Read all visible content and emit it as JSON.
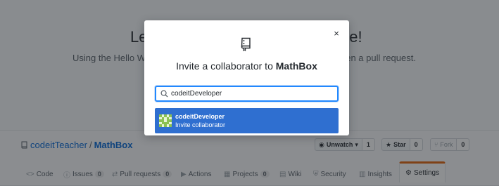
{
  "hero": {
    "title_left": "Le",
    "title_right": "de!",
    "subtitle_left": "Using the Hello Wo",
    "subtitle_right": "pen a pull request."
  },
  "repo": {
    "owner": "codeitTeacher",
    "separator": "/",
    "name": "MathBox",
    "watch": {
      "label": "Unwatch",
      "count": "1"
    },
    "star": {
      "label": "Star",
      "count": "0"
    },
    "fork": {
      "label": "Fork",
      "count": "0"
    }
  },
  "tabs": [
    {
      "icon": "<>",
      "label": "Code",
      "count": ""
    },
    {
      "icon": "ⓘ",
      "label": "Issues",
      "count": "0"
    },
    {
      "icon": "⇄",
      "label": "Pull requests",
      "count": "0"
    },
    {
      "icon": "▶",
      "label": "Actions",
      "count": ""
    },
    {
      "icon": "▦",
      "label": "Projects",
      "count": "0"
    },
    {
      "icon": "▤",
      "label": "Wiki",
      "count": ""
    },
    {
      "icon": "⛨",
      "label": "Security",
      "count": ""
    },
    {
      "icon": "▥",
      "label": "Insights",
      "count": ""
    },
    {
      "icon": "⚙",
      "label": "Settings",
      "count": ""
    }
  ],
  "selected_tab": "Settings",
  "modal": {
    "close_label": "×",
    "title_prefix": "Invite a collaborator to",
    "title_repo": "MathBox",
    "search": {
      "value": "codeitDeveloper",
      "placeholder": ""
    },
    "suggestion": {
      "login": "codeitDeveloper",
      "action": "Invite collaborator"
    }
  },
  "colors": {
    "accent": "#2188ff",
    "suggestion_bg": "#2f6fd0",
    "selected_tab_border": "#e36209",
    "link": "#0366d6"
  },
  "icons": {
    "repo": "repo-icon",
    "search": "search-icon",
    "close": "close-icon"
  }
}
